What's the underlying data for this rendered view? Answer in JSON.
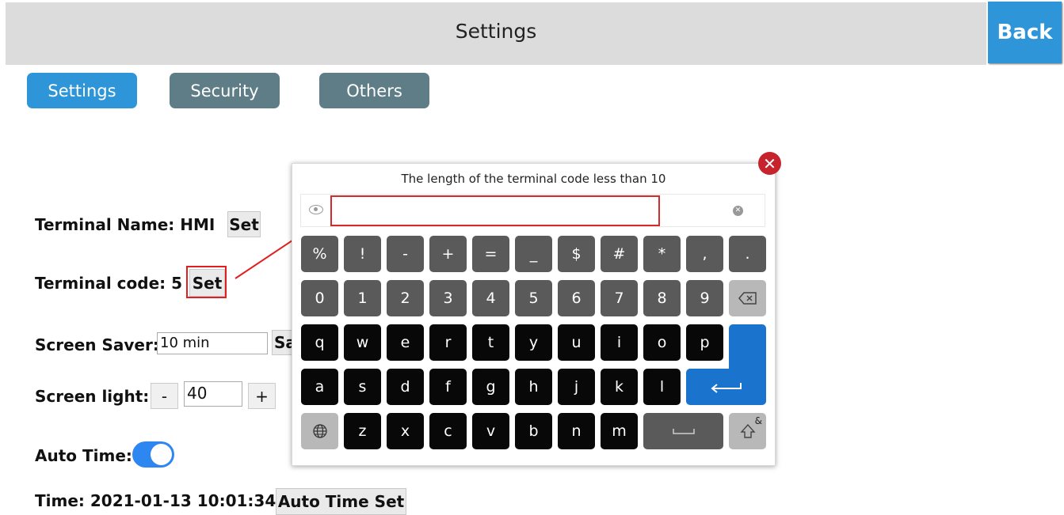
{
  "header": {
    "title": "Settings",
    "back_label": "Back"
  },
  "tabs": [
    {
      "label": "Settings",
      "active": true
    },
    {
      "label": "Security",
      "active": false
    },
    {
      "label": "Others",
      "active": false
    }
  ],
  "terminal_name": {
    "label": "Terminal Name: HMI",
    "set_label": "Set"
  },
  "terminal_code": {
    "label": "Terminal code: 5",
    "set_label": "Set"
  },
  "screen_saver": {
    "label": "Screen Saver:",
    "value": "10 min",
    "save_label": "Sa"
  },
  "screen_light": {
    "label": "Screen light:",
    "minus_label": "-",
    "value": "40",
    "plus_label": "+"
  },
  "auto_time": {
    "label": "Auto Time:",
    "enabled": true
  },
  "time": {
    "label": "Time: 2021-01-13 10:01:34",
    "button_label": "Auto Time Set"
  },
  "keyboard": {
    "title": "The length of the terminal code less than 10",
    "input_value": "",
    "row1": [
      "%",
      "!",
      "-",
      "+",
      "=",
      "_",
      "$",
      "#",
      "*",
      ",",
      "."
    ],
    "row2": [
      "0",
      "1",
      "2",
      "3",
      "4",
      "5",
      "6",
      "7",
      "8",
      "9"
    ],
    "row3": [
      "q",
      "w",
      "e",
      "r",
      "t",
      "y",
      "u",
      "i",
      "o",
      "p"
    ],
    "row4": [
      "a",
      "s",
      "d",
      "f",
      "g",
      "h",
      "j",
      "k",
      "l"
    ],
    "row5": [
      "z",
      "x",
      "c",
      "v",
      "b",
      "n",
      "m"
    ],
    "backspace_icon": "backspace-icon",
    "enter_icon": "enter-icon",
    "globe_icon": "globe-icon",
    "shift_icon": "shift-icon",
    "shift_label": "&",
    "space_label": "space"
  },
  "colors": {
    "accent": "#2e96d8",
    "tab_inactive": "#5f7d86",
    "highlight": "#e02020",
    "toggle": "#2e86f0",
    "enter_key": "#1a73cc",
    "close": "#c6232c"
  }
}
